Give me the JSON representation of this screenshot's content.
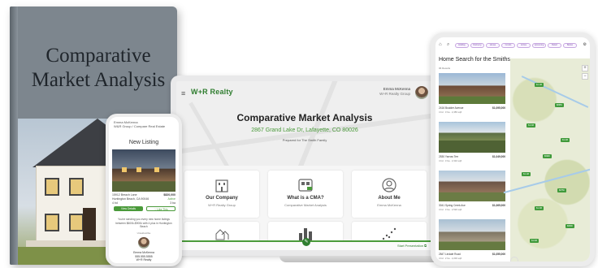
{
  "book": {
    "title_line1": "Comparative",
    "title_line2": "Market Analysis"
  },
  "laptop": {
    "logo": "W+R Realty",
    "agent_name": "Emma McKenna",
    "agent_sub": "W+R Realty Group",
    "title": "Comparative Market Analysis",
    "address": "2867 Grand Lake Dr, Lafayette, CO 80026",
    "prepared_for": "Prepared for The Smith Family",
    "cards": [
      {
        "title": "Our Company",
        "subtitle": "W+R Realty Group",
        "icon": "building-icon"
      },
      {
        "title": "What is a CMA?",
        "subtitle": "Comparative Market Analysis",
        "icon": "cma-icon"
      },
      {
        "title": "About Me",
        "subtitle": "Emma McKenna",
        "icon": "person-icon"
      }
    ],
    "start_label": "Start Presentation"
  },
  "phone": {
    "header_line1": "Emma McKenna",
    "header_line2": "W&R Group / Compare Real Estate",
    "title": "New Listing",
    "address": "15912 Breach Lane",
    "price": "$820,000",
    "city": "Huntington Beach, CA 90046",
    "status": "Active",
    "beds": "4 bd",
    "baths": "3 ba",
    "btn_primary": "View Details",
    "btn_secondary": "Like This",
    "note": "You're sending you every new home listings between $600k-$900k with 4 plus in Huntington Beach",
    "unsubscribe": "Unsubscribe",
    "agent_name": "Emma McKenna",
    "agent_phone": "555.555.5555",
    "agent_site": "W+R Realty"
  },
  "tablet": {
    "title": "Home Search for the Smiths",
    "count": "96 Results",
    "chips": [
      "Holiday",
      "Dalmony",
      "House",
      "Condo",
      "Active",
      "Upcoming",
      "Relief",
      "Below"
    ],
    "homes": [
      {
        "address": "2416 Boulder Avenue",
        "price": "$1,095,000",
        "details": "4 bd · 3 ba · 2,456 sqft"
      },
      {
        "address": "2530 Yarrow Terr",
        "price": "$1,049,000",
        "details": "4 bd · 3 ba · 2,310 sqft"
      },
      {
        "address": "3041 Spring Creek Ave",
        "price": "$1,065,000",
        "details": "4 bd · 3 ba · 2,520 sqft"
      },
      {
        "address": "2847 Lindale Road",
        "price": "$1,055,000",
        "details": "4 bd · 2 ba · 2,200 sqft"
      }
    ],
    "pins": [
      "$1.1M",
      "$895K",
      "$1.0M",
      "$1.2M",
      "$999K",
      "$1.1M",
      "$875K",
      "$1.3M",
      "$950K",
      "$1.0M"
    ]
  }
}
